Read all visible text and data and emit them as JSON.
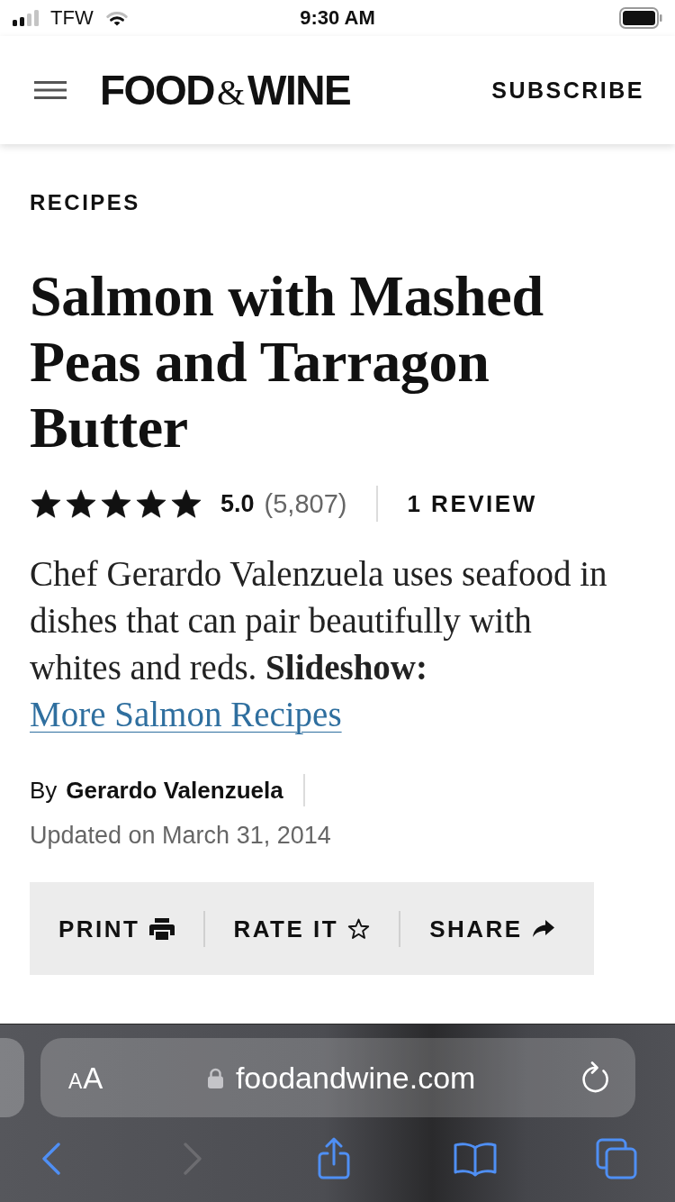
{
  "status_bar": {
    "carrier": "TFW",
    "time": "9:30 AM"
  },
  "header": {
    "logo": [
      {
        "text": "FOOD",
        "kind": "word"
      },
      {
        "text": "&",
        "kind": "ampersand"
      },
      {
        "text": "WINE",
        "kind": "word"
      }
    ],
    "subscribe": "SUBSCRIBE"
  },
  "article": {
    "category": "RECIPES",
    "title": "Salmon with Mashed Peas and Tarragon Butter",
    "rating": {
      "stars": 5,
      "score": "5.0",
      "count": "(5,807)"
    },
    "reviews": "1 REVIEW",
    "description": {
      "text": "Chef Gerardo Valenzuela uses seafood in dishes that can pair beautifully with whites and reds. **Slideshow:**",
      "link": "More Salmon Recipes"
    },
    "byline": {
      "prefix": "By",
      "author": "Gerardo Valenzuela"
    },
    "updated": "Updated on March 31, 2014",
    "actions": [
      {
        "kind": "print",
        "label": "PRINT"
      },
      {
        "kind": "rate",
        "label": "RATE IT"
      },
      {
        "kind": "share",
        "label": "SHARE"
      }
    ]
  },
  "browser": {
    "address_bar": {
      "text_size_button": "AA",
      "url": "foodandwine.com"
    },
    "toolbar": [
      {
        "kind": "back",
        "disabled": false
      },
      {
        "kind": "forward",
        "disabled": true
      },
      {
        "kind": "share",
        "disabled": false
      },
      {
        "kind": "bookmarks",
        "disabled": false
      },
      {
        "kind": "tabs",
        "disabled": false
      }
    ]
  }
}
